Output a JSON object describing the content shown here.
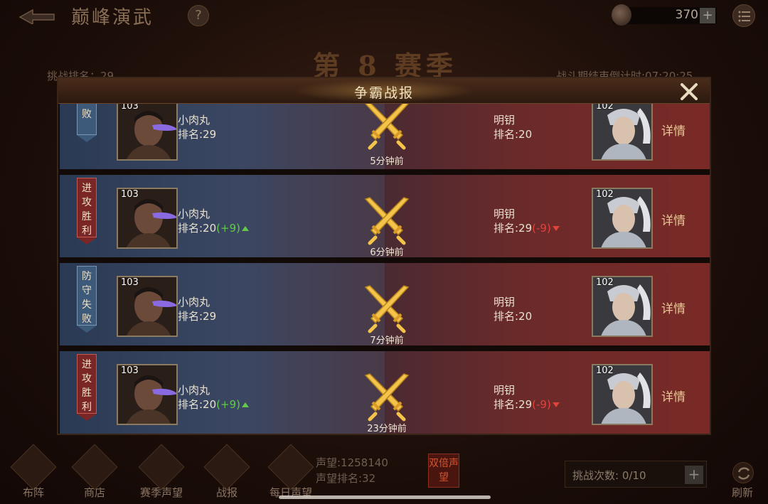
{
  "header": {
    "title": "巅峰演武",
    "help_label": "?",
    "currency_amount": "370",
    "currency_plus": "+"
  },
  "season": {
    "title": "第 8 赛季",
    "challenge_rank": "挑战排名：29",
    "countdown": "战斗期结束倒计时:07:20:25"
  },
  "modal": {
    "title": "争霸战报",
    "battles": [
      {
        "result": "守失败",
        "result_type": "fail",
        "player_level": "103",
        "player_name": "小肉丸",
        "player_rank": "排名:29",
        "player_change": "",
        "time": "5分钟前",
        "opponent_level": "102",
        "opponent_name": "明钥",
        "opponent_rank": "排名:20",
        "opponent_change": "",
        "detail": "详情"
      },
      {
        "result": "进攻胜利",
        "result_type": "win",
        "player_level": "103",
        "player_name": "小肉丸",
        "player_rank": "排名:20",
        "player_change": "(+9)",
        "time": "6分钟前",
        "opponent_level": "102",
        "opponent_name": "明钥",
        "opponent_rank": "排名:29",
        "opponent_change": "(-9)",
        "detail": "详情"
      },
      {
        "result": "防守失败",
        "result_type": "fail",
        "player_level": "103",
        "player_name": "小肉丸",
        "player_rank": "排名:29",
        "player_change": "",
        "time": "7分钟前",
        "opponent_level": "102",
        "opponent_name": "明钥",
        "opponent_rank": "排名:20",
        "opponent_change": "",
        "detail": "详情"
      },
      {
        "result": "进攻胜利",
        "result_type": "win",
        "player_level": "103",
        "player_name": "小肉丸",
        "player_rank": "排名:20",
        "player_change": "(+9)",
        "time": "23分钟前",
        "opponent_level": "102",
        "opponent_name": "明钥",
        "opponent_rank": "排名:29",
        "opponent_change": "(-9)",
        "detail": "详情"
      }
    ]
  },
  "bottom": {
    "nav": [
      {
        "label": "布阵",
        "icon": "formation-icon"
      },
      {
        "label": "商店",
        "icon": "shop-icon"
      },
      {
        "label": "赛季声望",
        "icon": "season-reputation-icon"
      },
      {
        "label": "战报",
        "icon": "battle-report-icon"
      },
      {
        "label": "每日声望",
        "icon": "daily-reputation-icon"
      }
    ],
    "reputation": "声望:1258140",
    "reputation_rank": "声望排名:32",
    "double_badge": "双倍声望",
    "attempts": "挑战次数: 0/10",
    "attempts_plus": "+",
    "refresh": "刷新"
  },
  "colors": {
    "blue_panel": "#3b4762",
    "red_panel": "#6a2a2a",
    "gold": "#e8c995",
    "rank_up": "#63c94a",
    "rank_down": "#e0433a"
  }
}
